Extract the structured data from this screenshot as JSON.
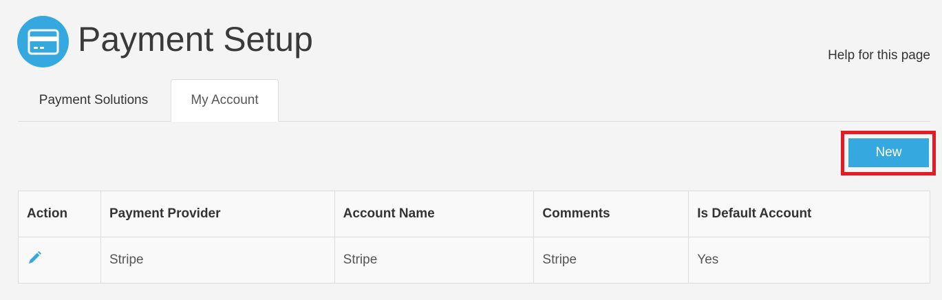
{
  "page": {
    "title": "Payment Setup",
    "icon": "credit-card-icon",
    "help_link": "Help for this page"
  },
  "tabs": [
    {
      "label": "Payment Solutions",
      "active": false
    },
    {
      "label": "My Account",
      "active": true
    }
  ],
  "toolbar": {
    "new_label": "New"
  },
  "table": {
    "columns": [
      "Action",
      "Payment Provider",
      "Account Name",
      "Comments",
      "Is Default Account"
    ],
    "rows": [
      {
        "action_icon": "pencil-icon",
        "provider": "Stripe",
        "account_name": "Stripe",
        "comments": "Stripe",
        "is_default": "Yes"
      }
    ]
  },
  "colors": {
    "accent": "#35a8e0",
    "highlight": "#e31b23",
    "background": "#f4f4f4"
  }
}
